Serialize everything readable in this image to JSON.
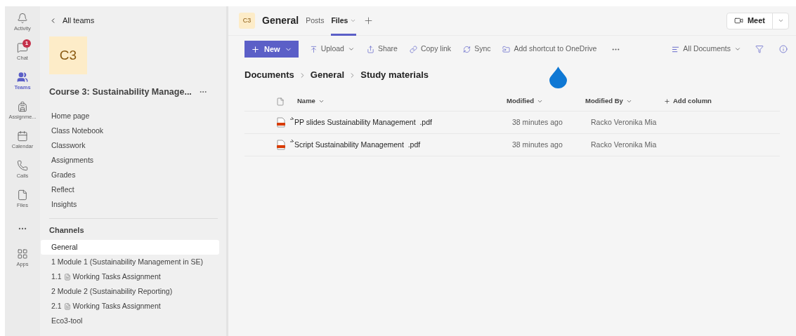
{
  "rail": [
    {
      "label": "Activity",
      "selected": false
    },
    {
      "label": "Chat",
      "selected": false,
      "badge": "1"
    },
    {
      "label": "Teams",
      "selected": true
    },
    {
      "label": "Assignme...",
      "selected": false
    },
    {
      "label": "Calendar",
      "selected": false
    },
    {
      "label": "Calls",
      "selected": false
    },
    {
      "label": "Files",
      "selected": false
    },
    {
      "label": "Apps",
      "selected": false
    }
  ],
  "sidebar": {
    "back": "All teams",
    "tile": "C3",
    "team_name": "Course 3: Sustainability Manage...",
    "items": [
      "Home page",
      "Class Notebook",
      "Classwork",
      "Assignments",
      "Grades",
      "Reflect",
      "Insights"
    ],
    "channels_heading": "Channels",
    "channels": [
      {
        "label": "General",
        "selected": true
      },
      {
        "label": "1 Module 1 (Sustainability Management in SE)",
        "selected": false
      },
      {
        "prefix": "1.1",
        "label": "Working Tasks Assignment",
        "selected": false,
        "kind": "doc"
      },
      {
        "label": "2 Module 2 (Sustainability Reporting)",
        "selected": false
      },
      {
        "prefix": "2.1",
        "label": "Working Tasks Assignment",
        "selected": false,
        "kind": "doc"
      },
      {
        "label": "Eco3-tool",
        "selected": false
      }
    ]
  },
  "header": {
    "tile": "C3",
    "title": "General",
    "tabs": [
      {
        "label": "Posts",
        "selected": false
      },
      {
        "label": "Files",
        "selected": true
      }
    ],
    "meet": "Meet"
  },
  "toolbar": {
    "new": "New",
    "actions": [
      "Upload",
      "Share",
      "Copy link",
      "Sync",
      "Add shortcut to OneDrive"
    ],
    "view": "All Documents"
  },
  "breadcrumb": [
    "Documents",
    "General",
    "Study materials"
  ],
  "table": {
    "columns": [
      "Name",
      "Modified",
      "Modified By"
    ],
    "add_column": "Add column",
    "rows": [
      {
        "name": "PP slides Sustainability Management  .pdf",
        "modified": "38 minutes ago",
        "modified_by": "Racko Veronika Mia"
      },
      {
        "name": "Script Sustainability Management  .pdf",
        "modified": "38 minutes ago",
        "modified_by": "Racko Veronika Mia"
      }
    ]
  }
}
